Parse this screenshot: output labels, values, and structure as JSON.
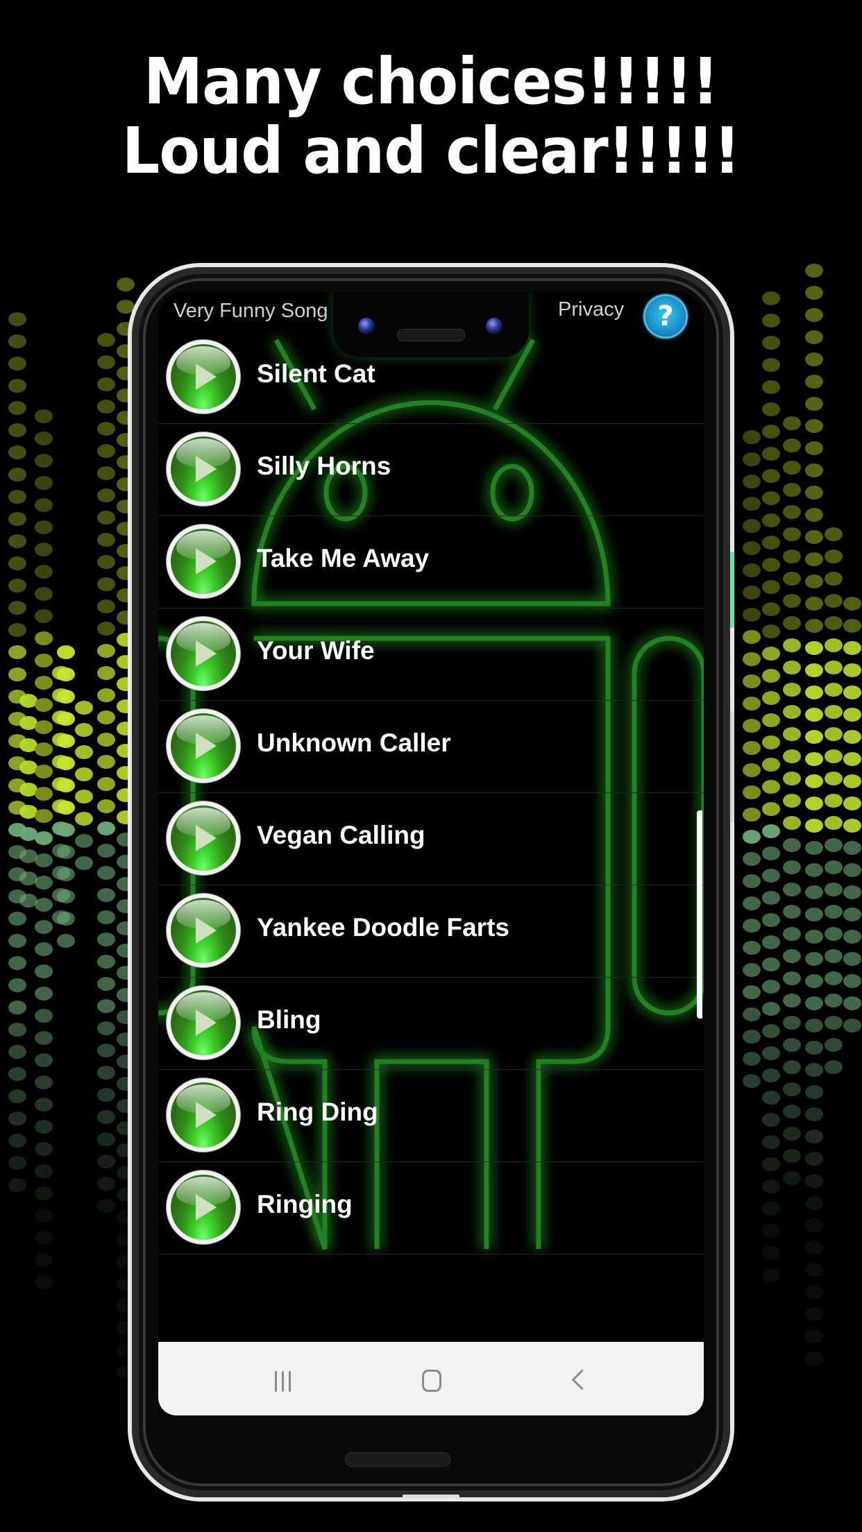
{
  "headline": {
    "line1": "Many choices!!!!!",
    "line2": "Loud and clear!!!!!"
  },
  "app": {
    "title": "Very Funny Song",
    "privacy_label": "Privacy",
    "help_icon": "?",
    "help_color": "#1a8fcc"
  },
  "songs": [
    {
      "title": "Silent Cat"
    },
    {
      "title": "Silly Horns"
    },
    {
      "title": "Take Me Away"
    },
    {
      "title": "Your Wife"
    },
    {
      "title": "Unknown Caller"
    },
    {
      "title": "Vegan Calling"
    },
    {
      "title": "Yankee Doodle Farts"
    },
    {
      "title": "Bling"
    },
    {
      "title": "Ring Ding"
    },
    {
      "title": "Ringing"
    }
  ],
  "icons": {
    "play": "play-icon",
    "help": "question-mark-icon",
    "recents": "recents-icon",
    "home": "home-icon",
    "back": "back-chevron-icon"
  },
  "colors": {
    "accent_green": "#3fcf2a",
    "neon_green": "#22c82a",
    "background": "#000000",
    "navbar": "#f2f2f2"
  }
}
